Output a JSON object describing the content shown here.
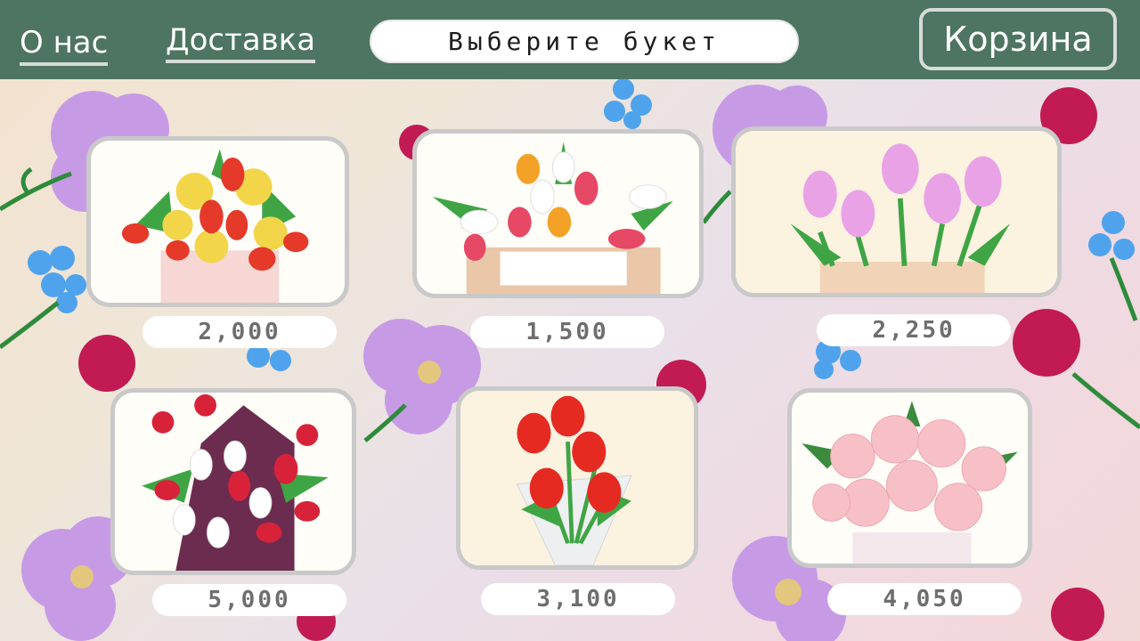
{
  "header": {
    "about_label": "О нас",
    "delivery_label": "Доставка",
    "search_text": "Выберите букет",
    "cart_label": "Корзина"
  },
  "bouquets": [
    {
      "price": "2,000",
      "image": "tulips-daffodils-icon"
    },
    {
      "price": "1,500",
      "image": "tulips-envelope-icon"
    },
    {
      "price": "2,250",
      "image": "pink-tulips-icon"
    },
    {
      "price": "5,000",
      "image": "tulips-hearts-box-icon"
    },
    {
      "price": "3,100",
      "image": "red-tulips-icon"
    },
    {
      "price": "4,050",
      "image": "peonies-icon"
    }
  ],
  "colors": {
    "header": "#4d7561",
    "card_border": "#c9c9c9",
    "price_text": "#6e6e6e"
  }
}
